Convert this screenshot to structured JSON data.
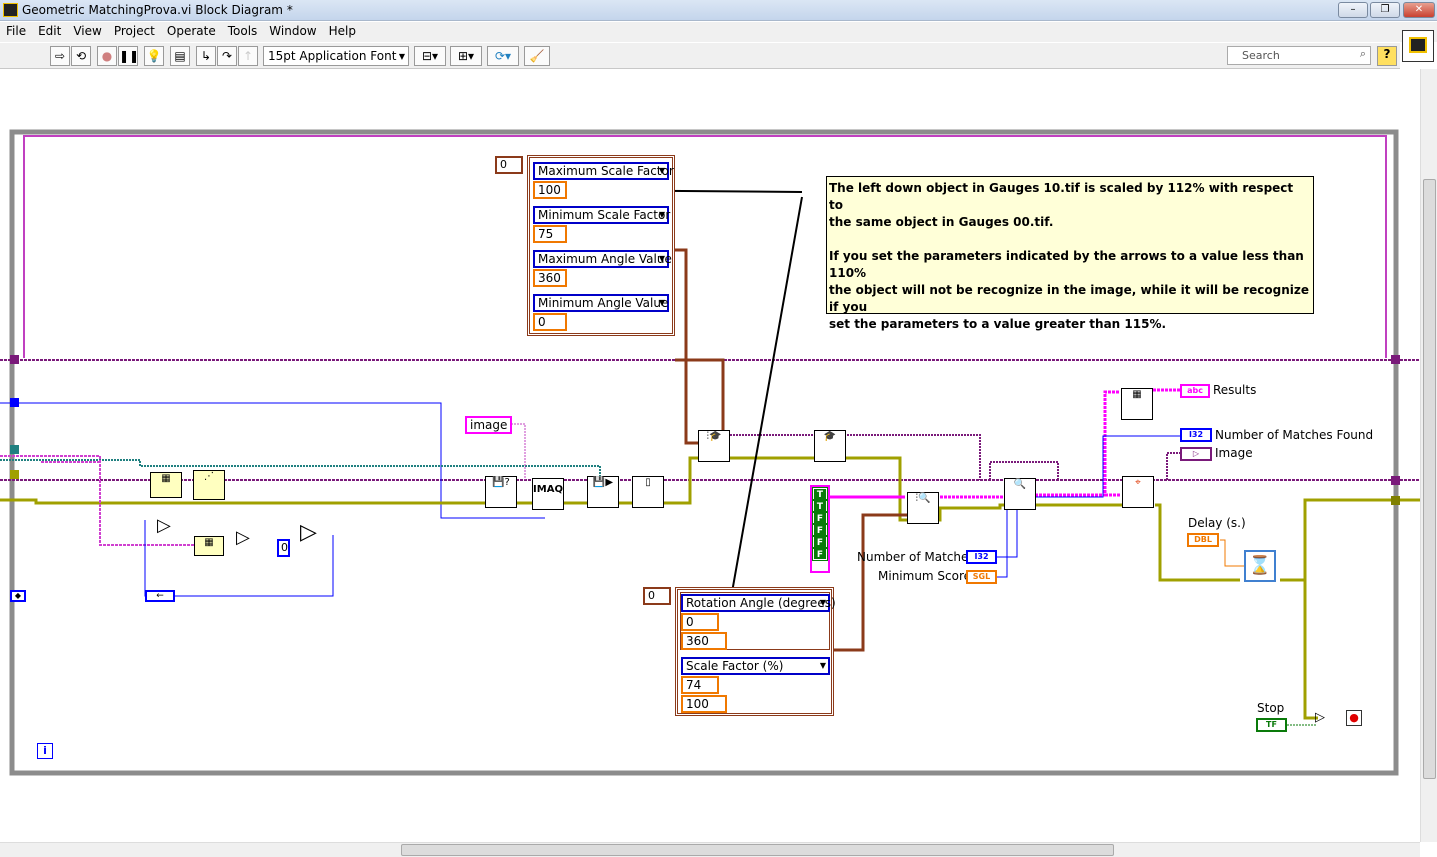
{
  "window": {
    "title": "Geometric MatchingProva.vi Block Diagram *",
    "min": "–",
    "max": "❐",
    "close": "✕"
  },
  "menu": [
    "File",
    "Edit",
    "View",
    "Project",
    "Operate",
    "Tools",
    "Window",
    "Help"
  ],
  "toolbar": {
    "font": "15pt Application Font",
    "search_placeholder": "Search",
    "help": "?"
  },
  "comment": {
    "line1": "The left down object in Gauges 10.tif  is scaled by 112% with respect to",
    "line2": "the same object in Gauges 00.tif.",
    "line3": "If you set the parameters indicated by the arrows to a value less than 110%",
    "line4": "the object will not be recognize in the image, while it will be recognize if you",
    "line5": "set the parameters to a value greater than 115%."
  },
  "top_cluster": {
    "index": "0",
    "items": [
      {
        "label": "Maximum Scale Factor",
        "value": "100"
      },
      {
        "label": "Minimum Scale Factor",
        "value": "75"
      },
      {
        "label": "Maximum Angle Value",
        "value": "360"
      },
      {
        "label": "Minimum Angle Value",
        "value": "0"
      }
    ]
  },
  "bottom_cluster": {
    "index": "0",
    "rotation_label": "Rotation Angle (degrees)",
    "rotation_min": "0",
    "rotation_max": "360",
    "scale_label": "Scale Factor (%)",
    "scale_min": "74",
    "scale_max": "100"
  },
  "labels": {
    "image": "image",
    "results": "Results",
    "matches_found": "Number of Matches Found",
    "image_out": "Image",
    "num_matches": "Number of Matches",
    "min_score": "Minimum Score",
    "delay": "Delay (s.)",
    "stop": "Stop"
  },
  "terminals": {
    "abc": "abc",
    "i32": "I32",
    "path": "▷",
    "sgl": "SGL",
    "dbl": "DBL",
    "tf": "TF",
    "imaq": "IMAQ"
  },
  "constants": {
    "zero": "0",
    "loop_i": "i"
  },
  "bool_array": [
    "T",
    "T",
    "F",
    "F",
    "F",
    "F"
  ],
  "colors": {
    "loop": "#8c8c8c",
    "case": "#c040c0",
    "int_wire": "#0000ff",
    "float_wire": "#f07800",
    "image_wire": "#7a1a7a",
    "string_wire": "#ff00ff",
    "error_wire": "#a0a000",
    "cluster_wire": "#8b3a1a",
    "comment_bg": "#ffffd8"
  }
}
